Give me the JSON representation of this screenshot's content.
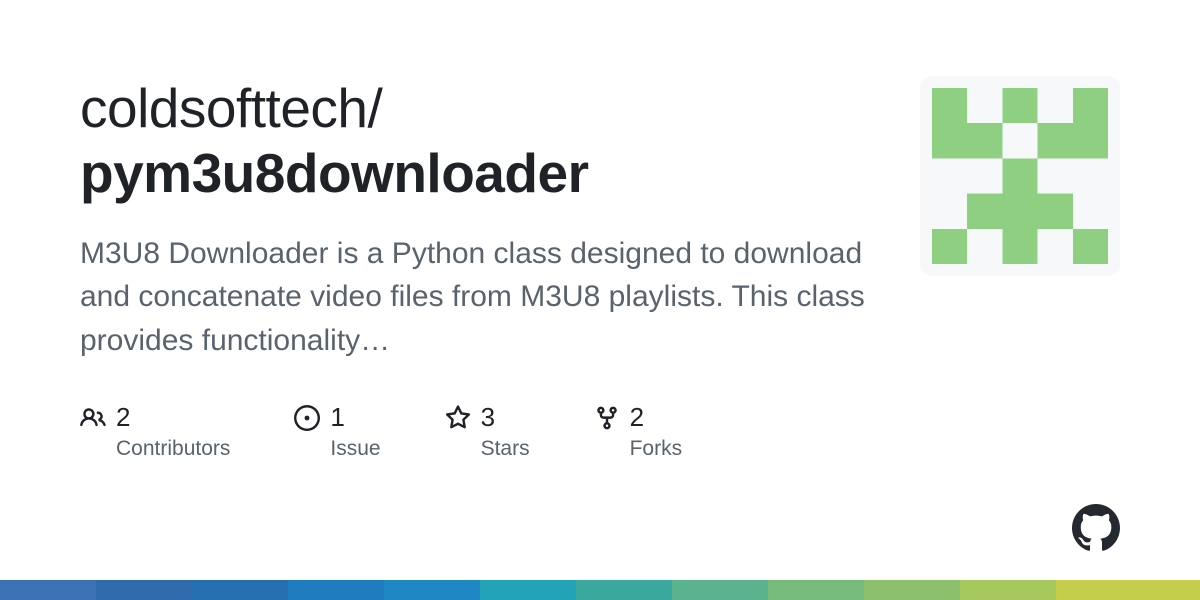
{
  "repo": {
    "owner": "coldsofttech",
    "name": "pym3u8downloader",
    "description": "M3U8 Downloader is a Python class designed to download and concatenate video files from M3U8 playlists. This class provides functionality…"
  },
  "stats": {
    "contributors": {
      "count": "2",
      "label": "Contributors"
    },
    "issues": {
      "count": "1",
      "label": "Issue"
    },
    "stars": {
      "count": "3",
      "label": "Stars"
    },
    "forks": {
      "count": "2",
      "label": "Forks"
    }
  }
}
